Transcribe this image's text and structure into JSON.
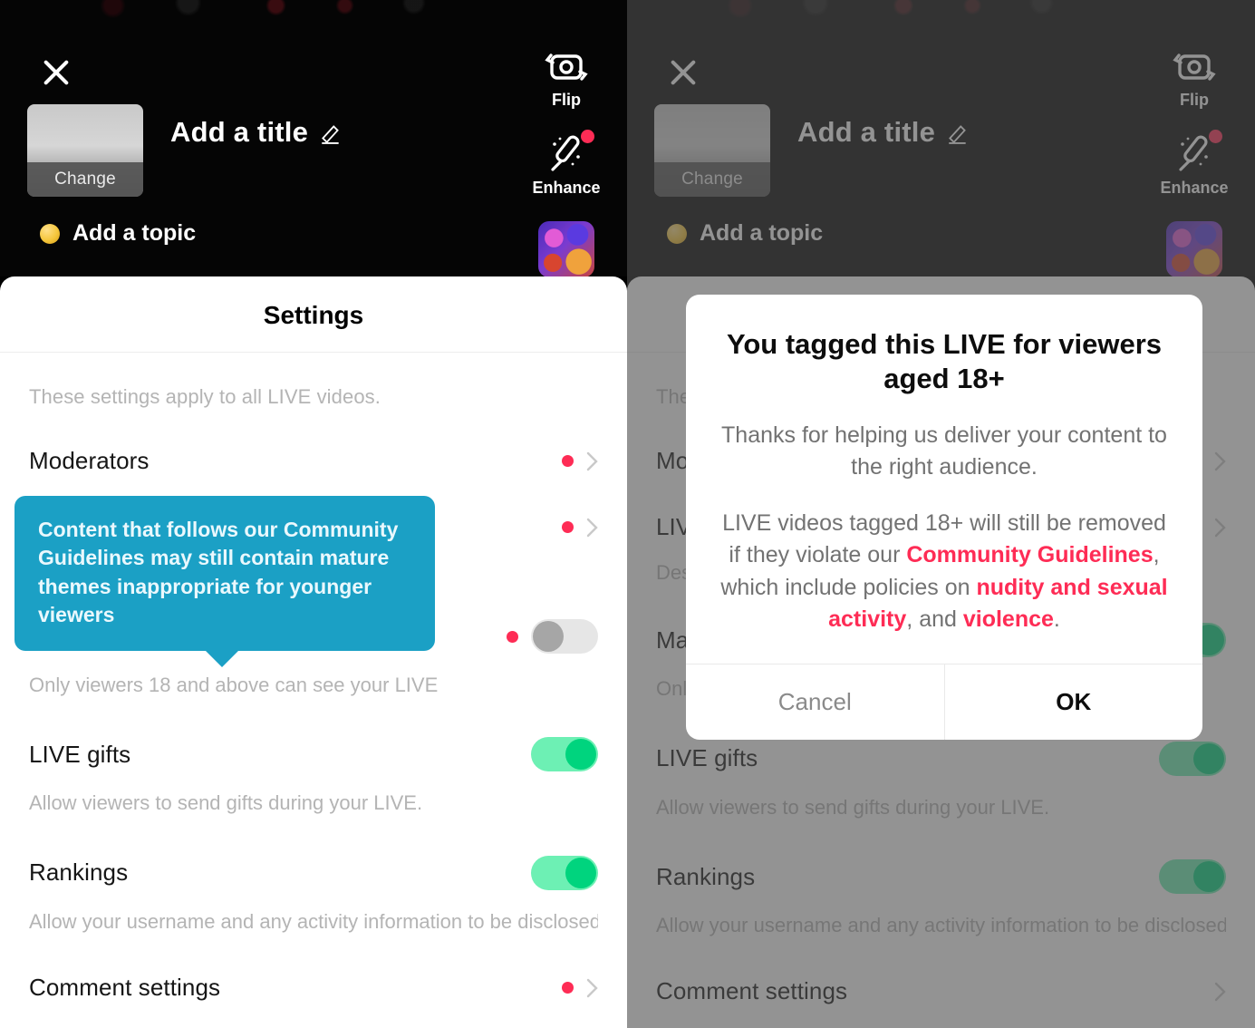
{
  "live_header": {
    "close_label": "Close",
    "thumbnail_change_label": "Change",
    "title_placeholder": "Add a title",
    "topic_label": "Add a topic",
    "tools": [
      {
        "label": "Flip",
        "icon": "flip-camera-icon",
        "badge": false
      },
      {
        "label": "Enhance",
        "icon": "magic-wand-icon",
        "badge": true
      }
    ],
    "sticker_label": "Sticker"
  },
  "settings": {
    "title": "Settings",
    "note": "These settings apply to all LIVE videos.",
    "rows": [
      {
        "label": "Moderators",
        "type": "link",
        "dot": true,
        "desc": ""
      },
      {
        "label": "LIVE",
        "type": "link",
        "dot": true,
        "desc": "Des"
      },
      {
        "label": "Mature themes",
        "type": "toggle",
        "dot": true,
        "toggle_on": false,
        "help": true,
        "desc": "Only viewers 18 and above can see your LIVE"
      },
      {
        "label": "LIVE gifts",
        "type": "toggle",
        "dot": false,
        "toggle_on": true,
        "desc": "Allow viewers to send gifts during your LIVE."
      },
      {
        "label": "Rankings",
        "type": "toggle",
        "dot": false,
        "toggle_on": true,
        "desc": "Allow your username and any activity information to be disclosed on feature with host and viewer rankings. This set does not apply to rankings on LIVE Campaigns."
      },
      {
        "label": "Comment settings",
        "type": "link",
        "dot": true,
        "desc": ""
      }
    ]
  },
  "tooltip": {
    "text": "Content that follows our Community Guidelines may still contain mature themes inappropriate for younger viewers",
    "background": "#1ba0c5",
    "text_color": "#eaf8fd"
  },
  "modal": {
    "heading": "You tagged this LIVE for viewers aged 18+",
    "paragraph1": "Thanks for helping us deliver your content to the right audience.",
    "p2_a": "LIVE videos tagged 18+ will still be removed if they violate our ",
    "p2_hl1": "Community Guidelines",
    "p2_b": ", which include policies on ",
    "p2_hl2": "nudity and sexual activity",
    "p2_c": ", and ",
    "p2_hl3": "violence",
    "p2_d": ".",
    "cancel_label": "Cancel",
    "ok_label": "OK",
    "highlight_color": "#fe2c55"
  },
  "colors": {
    "accent_red": "#fe2c55",
    "toggle_on": "#00d47e",
    "toggle_track_on": "#6df0b4",
    "tooltip_teal": "#1ba0c5"
  }
}
